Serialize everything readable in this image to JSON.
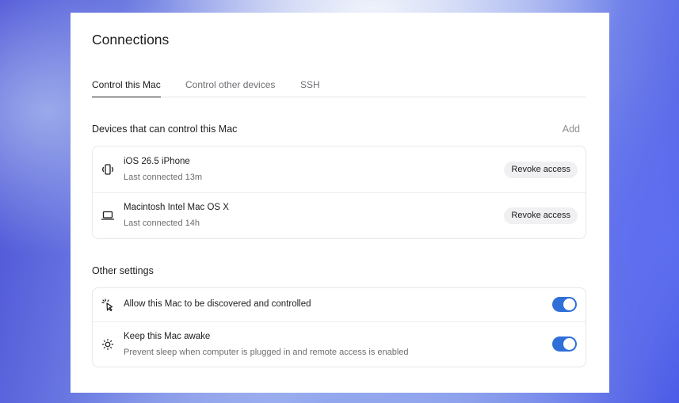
{
  "page": {
    "title": "Connections"
  },
  "tabs": [
    {
      "label": "Control this Mac",
      "active": true
    },
    {
      "label": "Control other devices",
      "active": false
    },
    {
      "label": "SSH",
      "active": false
    }
  ],
  "devices_section": {
    "title": "Devices that can control this Mac",
    "add_label": "Add",
    "devices": [
      {
        "icon": "phone-vibrate-icon",
        "name": "iOS 26.5 iPhone",
        "last_connected": "Last connected 13m",
        "action": "Revoke access"
      },
      {
        "icon": "laptop-icon",
        "name": "Macintosh Intel Mac OS X",
        "last_connected": "Last connected 14h",
        "action": "Revoke access"
      }
    ]
  },
  "other_settings": {
    "title": "Other settings",
    "items": [
      {
        "icon": "cursor-click-icon",
        "label": "Allow this Mac to be discovered and controlled",
        "enabled": true
      },
      {
        "icon": "sun-icon",
        "label": "Keep this Mac awake",
        "description": "Prevent sleep when computer is plugged in and remote access is enabled",
        "enabled": true
      }
    ]
  },
  "colors": {
    "accent": "#2f6fd8",
    "panel": "#ffffff",
    "text": "#1d1d1f",
    "muted": "#6e6e73"
  }
}
